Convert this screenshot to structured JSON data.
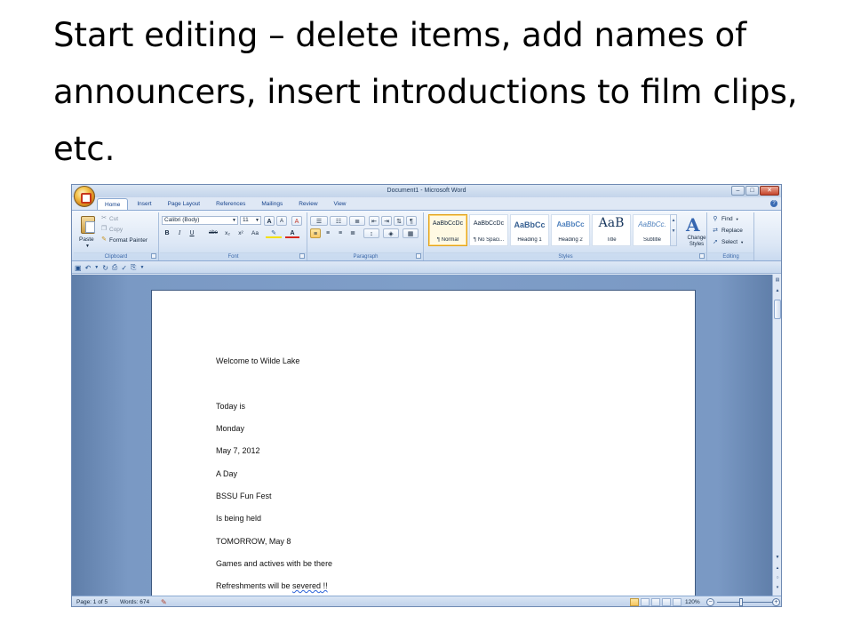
{
  "slide": {
    "title": "Start editing – delete items, add names of announcers, insert introductions to film clips, etc."
  },
  "window": {
    "title": "Document1 - Microsoft Word",
    "minimize": "–",
    "maximize": "□",
    "close": "✕"
  },
  "tabs": [
    "Home",
    "Insert",
    "Page Layout",
    "References",
    "Mailings",
    "Review",
    "View"
  ],
  "active_tab": "Home",
  "ribbon": {
    "clipboard": {
      "label": "Clipboard",
      "paste": "Paste",
      "cut": "Cut",
      "copy": "Copy",
      "format_painter": "Format Painter"
    },
    "font": {
      "label": "Font",
      "font_name": "Calibri (Body)",
      "font_size": "11",
      "grow": "A",
      "shrink": "A",
      "clear": "A",
      "bold": "B",
      "italic": "I",
      "underline": "U",
      "strike": "abe",
      "subscript": "x₂",
      "superscript": "x²",
      "change_case": "Aa",
      "font_color": "A"
    },
    "paragraph": {
      "label": "Paragraph",
      "pilcrow": "¶"
    },
    "styles": {
      "label": "Styles",
      "items": [
        {
          "sample": "AaBbCcDc",
          "name": "¶ Normal"
        },
        {
          "sample": "AaBbCcDc",
          "name": "¶ No Spaci..."
        },
        {
          "sample": "AaBbCc",
          "name": "Heading 1"
        },
        {
          "sample": "AaBbCc",
          "name": "Heading 2"
        },
        {
          "sample": "AaB",
          "name": "Title"
        },
        {
          "sample": "AaBbCc.",
          "name": "Subtitle"
        }
      ],
      "change_styles_icon": "A",
      "change_styles": "Change Styles"
    },
    "editing": {
      "label": "Editing",
      "find": "Find",
      "replace": "Replace",
      "select": "Select"
    }
  },
  "document": {
    "lines": [
      "Welcome to Wilde Lake",
      "Today is",
      "Monday",
      "May 7, 2012",
      "A Day",
      "BSSU Fun Fest",
      "Is being held",
      "TOMORROW, May 8",
      "Games and actives with be there"
    ],
    "last_line_prefix": "Refreshments will be ",
    "last_line_word": "severed",
    "last_line_suffix": " !!"
  },
  "statusbar": {
    "page": "Page: 1 of 5",
    "words": "Words: 674",
    "zoom": "120%",
    "zoom_out": "−",
    "zoom_in": "+"
  }
}
